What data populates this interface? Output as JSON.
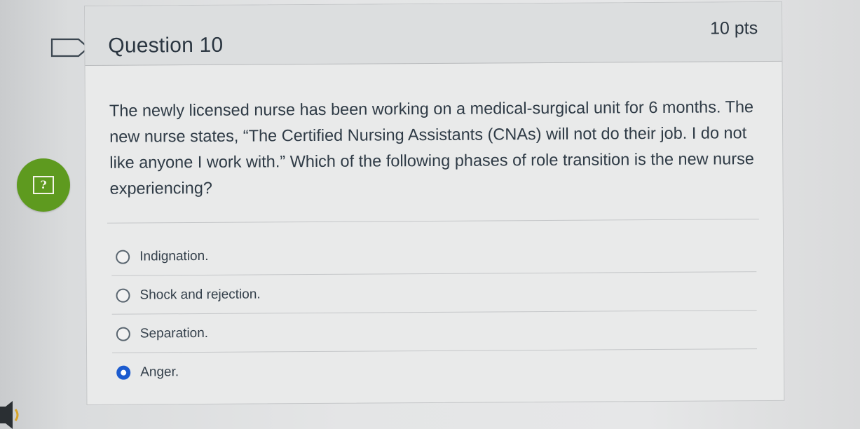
{
  "question": {
    "title": "Question 10",
    "points": "10 pts",
    "text": "The newly licensed nurse has been working on a medical-surgical unit for 6 months. The new nurse states, “The Certified Nursing Assistants (CNAs) will not do their job. I do not like anyone I work with.” Which of the following phases of role transition is the new nurse experiencing?"
  },
  "answers": [
    {
      "label": "Indignation.",
      "selected": false
    },
    {
      "label": "Shock and rejection.",
      "selected": false
    },
    {
      "label": "Separation.",
      "selected": false
    },
    {
      "label": "Anger.",
      "selected": true
    }
  ],
  "help_button": {
    "glyph": "?"
  },
  "colors": {
    "selected_radio": "#1c5bcf",
    "help_bubble": "#5e9a1f",
    "header_bg": "#dcdedf"
  },
  "icons": [
    "flag-icon",
    "help-icon",
    "speaker-icon"
  ]
}
